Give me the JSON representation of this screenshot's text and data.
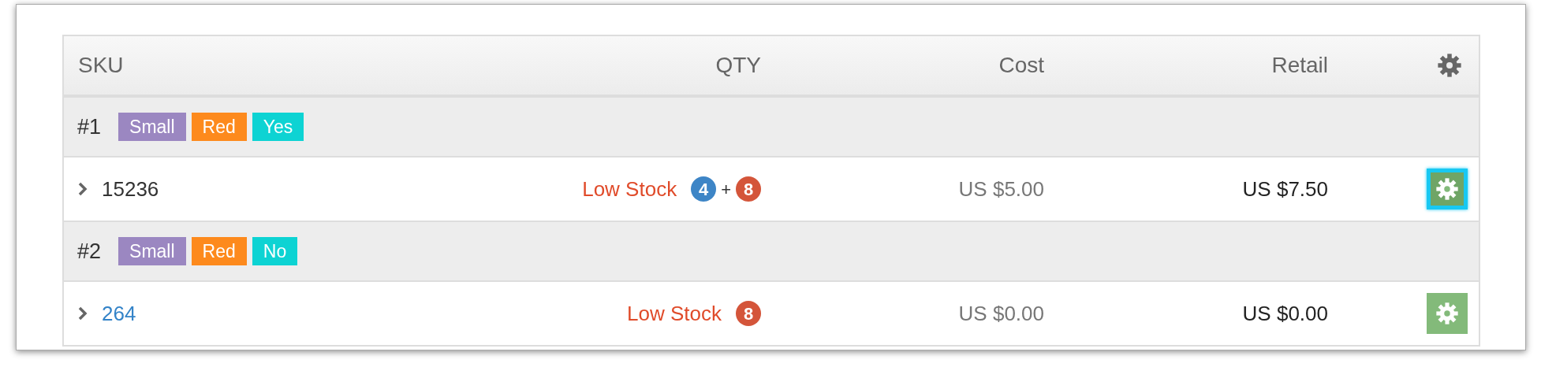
{
  "table": {
    "columns": [
      {
        "kind": "text",
        "label": "SKU"
      },
      {
        "kind": "text",
        "label": "QTY"
      },
      {
        "kind": "text",
        "label": "Cost"
      },
      {
        "kind": "text",
        "label": "Retail"
      },
      {
        "kind": "gear"
      }
    ],
    "groups": [
      {
        "number": "#1",
        "tags": [
          {
            "text": "Small",
            "color": "#9b87c1"
          },
          {
            "text": "Red",
            "color": "#fd8a1d"
          },
          {
            "text": "Yes",
            "color": "#0dd3d3"
          }
        ],
        "item": {
          "sku": "15236",
          "link": false,
          "status": "Low Stock",
          "counts": [
            {
              "kind": "count",
              "text": "4",
              "color": "#3d85c6"
            },
            {
              "kind": "plus",
              "text": "+"
            },
            {
              "kind": "count",
              "text": "8",
              "color": "#d4553a"
            }
          ],
          "cost": "US $5.00",
          "retail": "US $7.50",
          "focused": true
        }
      },
      {
        "number": "#2",
        "tags": [
          {
            "text": "Small",
            "color": "#9b87c1"
          },
          {
            "text": "Red",
            "color": "#fd8a1d"
          },
          {
            "text": "No",
            "color": "#0dd3d3"
          }
        ],
        "item": {
          "sku": "264",
          "link": true,
          "status": "Low Stock",
          "counts": [
            {
              "kind": "count",
              "text": "8",
              "color": "#d4553a"
            }
          ],
          "cost": "US $0.00",
          "retail": "US $0.00",
          "focused": false
        }
      }
    ]
  }
}
